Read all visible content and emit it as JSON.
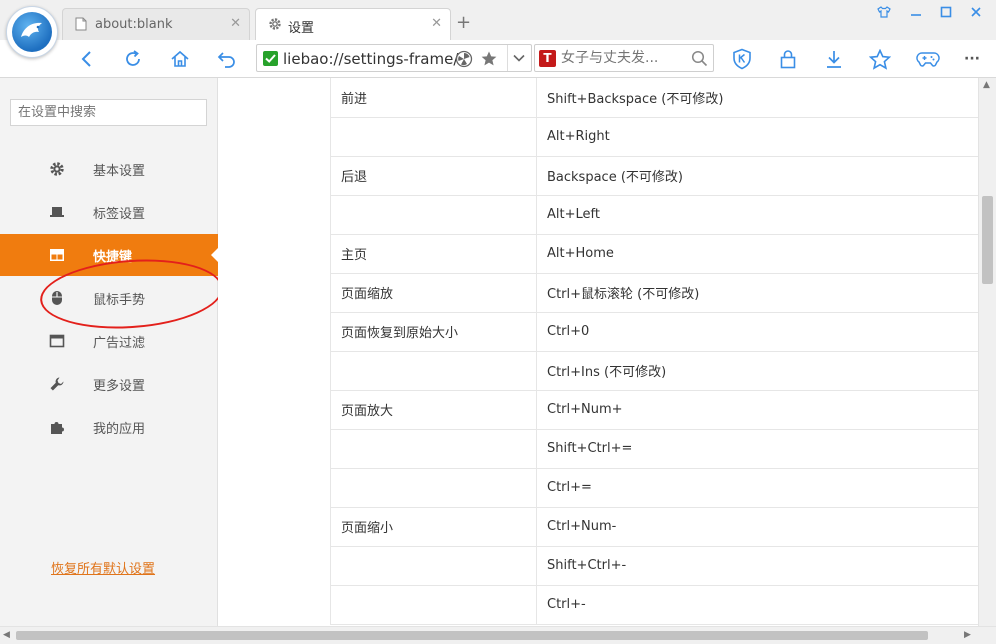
{
  "tabs": [
    {
      "title": "about:blank",
      "close": "✕",
      "active": false
    },
    {
      "title": "设置",
      "close": "✕",
      "active": true
    }
  ],
  "new_tab": "+",
  "address": {
    "url": "liebao://settings-frame/"
  },
  "search": {
    "placeholder": "女子与丈夫发...",
    "engine": "T"
  },
  "toolbar_more": "···",
  "sidebar": {
    "search_placeholder": "在设置中搜索",
    "items": [
      {
        "label": "基本设置",
        "icon": "gear-icon"
      },
      {
        "label": "标签设置",
        "icon": "laptop-icon"
      },
      {
        "label": "快捷键",
        "icon": "grid-icon",
        "active": true
      },
      {
        "label": "鼠标手势",
        "icon": "mouse-icon"
      },
      {
        "label": "广告过滤",
        "icon": "window-icon"
      },
      {
        "label": "更多设置",
        "icon": "wrench-icon"
      },
      {
        "label": "我的应用",
        "icon": "puzzle-icon"
      }
    ],
    "restore_label": "恢复所有默认设置"
  },
  "shortcuts": [
    {
      "action": "前进",
      "key": "Shift+Backspace (不可修改)"
    },
    {
      "action": "",
      "key": "Alt+Right"
    },
    {
      "action": "后退",
      "key": "Backspace (不可修改)"
    },
    {
      "action": "",
      "key": "Alt+Left"
    },
    {
      "action": "主页",
      "key": "Alt+Home"
    },
    {
      "action": "页面缩放",
      "key": "Ctrl+鼠标滚轮 (不可修改)"
    },
    {
      "action": "页面恢复到原始大小",
      "key": "Ctrl+0"
    },
    {
      "action": "",
      "key": "Ctrl+Ins (不可修改)"
    },
    {
      "action": "页面放大",
      "key": "Ctrl+Num+"
    },
    {
      "action": "",
      "key": "Shift+Ctrl+="
    },
    {
      "action": "",
      "key": "Ctrl+="
    },
    {
      "action": "页面缩小",
      "key": "Ctrl+Num-"
    },
    {
      "action": "",
      "key": "Shift+Ctrl+-"
    },
    {
      "action": "",
      "key": "Ctrl+-"
    }
  ],
  "colors": {
    "accent": "#f07c0f",
    "icon_blue": "#3a8ee6",
    "annotation": "#e3201b"
  }
}
